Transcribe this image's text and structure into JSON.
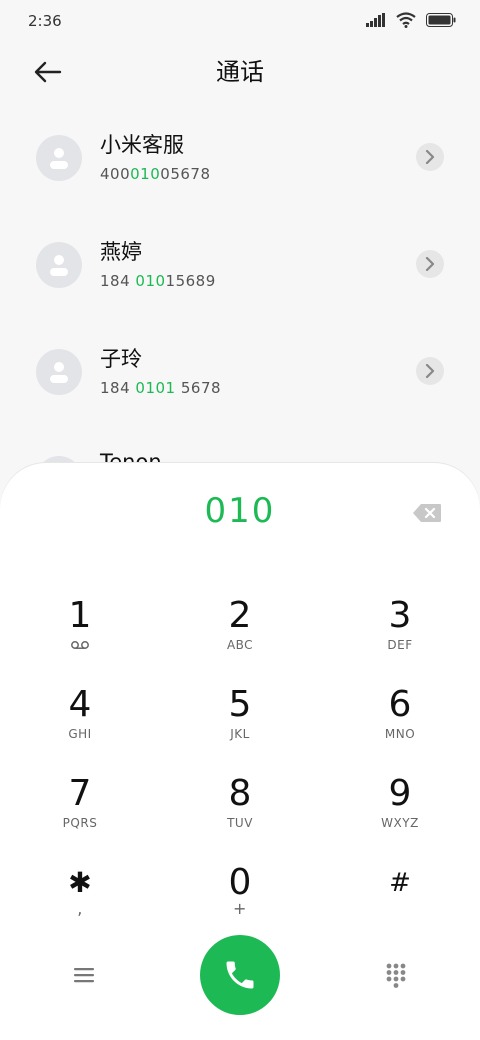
{
  "status": {
    "time": "2:36"
  },
  "header": {
    "title": "通话"
  },
  "contacts": [
    {
      "name": "小米客服",
      "num_before": "400",
      "num_match": "010",
      "num_after": "05678"
    },
    {
      "name": "燕婷",
      "num_before": "184 ",
      "num_match": "010",
      "num_after": "15689"
    },
    {
      "name": "子玲",
      "num_before": "184 ",
      "num_match": "0101",
      "num_after": " 5678"
    },
    {
      "name": "Tenon",
      "num_before": "",
      "num_match": "",
      "num_after": ""
    }
  ],
  "dialpad": {
    "input": "010",
    "keys": [
      {
        "digit": "1",
        "letters": ""
      },
      {
        "digit": "2",
        "letters": "ABC"
      },
      {
        "digit": "3",
        "letters": "DEF"
      },
      {
        "digit": "4",
        "letters": "GHI"
      },
      {
        "digit": "5",
        "letters": "JKL"
      },
      {
        "digit": "6",
        "letters": "MNO"
      },
      {
        "digit": "7",
        "letters": "PQRS"
      },
      {
        "digit": "8",
        "letters": "TUV"
      },
      {
        "digit": "9",
        "letters": "WXYZ"
      },
      {
        "digit": "✱",
        "letters": ","
      },
      {
        "digit": "0",
        "letters": "+"
      },
      {
        "digit": "#",
        "letters": ""
      }
    ]
  },
  "colors": {
    "accent": "#1db954"
  }
}
